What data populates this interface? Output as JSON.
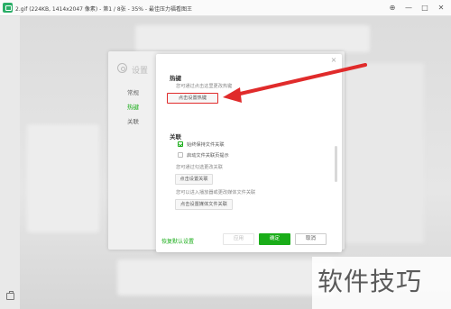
{
  "titlebar": {
    "title": "2.gif (224KB, 1414x2047 像素) - 第1 / 8张 - 35% - 最佳压力福看图王",
    "pin_glyph": "⊕",
    "minimize_glyph": "—",
    "maximize_glyph": "□",
    "close_glyph": "✕"
  },
  "settings": {
    "heading": "设置",
    "nav": [
      {
        "label": "常规",
        "active": false
      },
      {
        "label": "热键",
        "active": true
      },
      {
        "label": "关联",
        "active": false
      }
    ]
  },
  "dialog": {
    "close_glyph": "×",
    "hotkey_section": {
      "title": "热键",
      "hint": "您可通过点击这里更改热键",
      "button": "点击设置热键"
    },
    "assoc_section": {
      "title": "关联",
      "options": [
        {
          "label": "始终保持文件关联",
          "checked": true
        },
        {
          "label": "启动文件关联页提示",
          "checked": false
        }
      ],
      "hint1": "您可通过勾选更改关联",
      "button1": "点击设置关联",
      "hint2": "您可以进入播放器或更改媒体文件关联",
      "button2": "点击设置媒体文件关联"
    },
    "footer": {
      "restore_link": "恢复默认设置",
      "apply": "应用",
      "ok": "确定",
      "cancel": "取消"
    }
  },
  "watermark": {
    "text": "软件技巧"
  },
  "colors": {
    "accent": "#1aad19",
    "annotation": "#e02b2b"
  }
}
